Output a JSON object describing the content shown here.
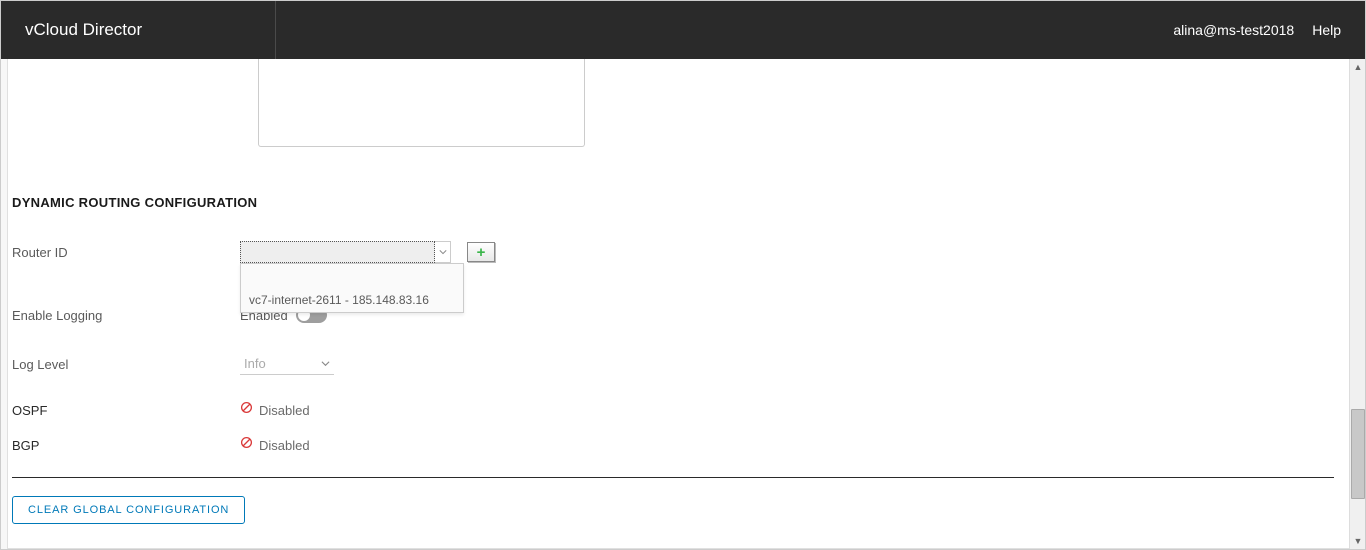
{
  "header": {
    "title": "vCloud Director",
    "user": "alina@ms-test2018",
    "help": "Help"
  },
  "section": {
    "heading": "DYNAMIC ROUTING CONFIGURATION"
  },
  "routerId": {
    "label": "Router ID",
    "options": [
      "vc7-internet-2611 - 185.148.83.16"
    ]
  },
  "logging": {
    "label": "Enable Logging",
    "enabledText": "Enabled",
    "state": false
  },
  "logLevel": {
    "label": "Log Level",
    "value": "Info"
  },
  "ospf": {
    "label": "OSPF",
    "status": "Disabled"
  },
  "bgp": {
    "label": "BGP",
    "status": "Disabled"
  },
  "actions": {
    "clear": "CLEAR GLOBAL CONFIGURATION"
  }
}
